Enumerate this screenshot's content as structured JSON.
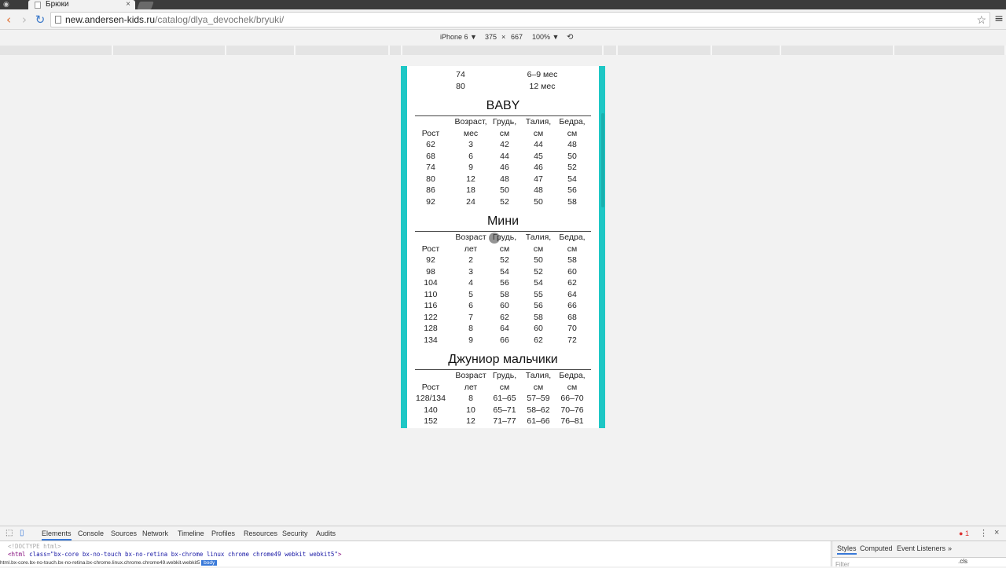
{
  "browser": {
    "tab_title": "Брюки",
    "url_host": "new.andersen-kids.ru",
    "url_path": "/catalog/dlya_devochek/bryuki/"
  },
  "device_toolbar": {
    "device": "iPhone 6 ▼",
    "width": "375",
    "times": "×",
    "height": "667",
    "zoom": "100% ▼"
  },
  "page": {
    "prev_rows": [
      [
        "74",
        "6–9 мес"
      ],
      [
        "80",
        "12 мес"
      ]
    ],
    "sections": [
      {
        "title": "BABY",
        "header_top": [
          "Возраст,",
          "Грудь,",
          "Талия,",
          "Бедра,"
        ],
        "header_bottom": [
          "Рост",
          "мес",
          "см",
          "см",
          "см"
        ],
        "rows": [
          [
            "62",
            "3",
            "42",
            "44",
            "48"
          ],
          [
            "68",
            "6",
            "44",
            "45",
            "50"
          ],
          [
            "74",
            "9",
            "46",
            "46",
            "52"
          ],
          [
            "80",
            "12",
            "48",
            "47",
            "54"
          ],
          [
            "86",
            "18",
            "50",
            "48",
            "56"
          ],
          [
            "92",
            "24",
            "52",
            "50",
            "58"
          ]
        ]
      },
      {
        "title": "Мини",
        "header_top": [
          "Возраст",
          "Грудь,",
          "Талия,",
          "Бедра,"
        ],
        "header_bottom": [
          "Рост",
          "лет",
          "см",
          "см",
          "см"
        ],
        "rows": [
          [
            "92",
            "2",
            "52",
            "50",
            "58"
          ],
          [
            "98",
            "3",
            "54",
            "52",
            "60"
          ],
          [
            "104",
            "4",
            "56",
            "54",
            "62"
          ],
          [
            "110",
            "5",
            "58",
            "55",
            "64"
          ],
          [
            "116",
            "6",
            "60",
            "56",
            "66"
          ],
          [
            "122",
            "7",
            "62",
            "58",
            "68"
          ],
          [
            "128",
            "8",
            "64",
            "60",
            "70"
          ],
          [
            "134",
            "9",
            "66",
            "62",
            "72"
          ]
        ]
      },
      {
        "title": "Джуниор мальчики",
        "header_top": [
          "Возраст",
          "Грудь,",
          "Талия,",
          "Бедра,"
        ],
        "header_bottom": [
          "Рост",
          "лет",
          "см",
          "см",
          "см"
        ],
        "rows": [
          [
            "128/134",
            "8",
            "61–65",
            "57–59",
            "66–70"
          ],
          [
            "140",
            "10",
            "65–71",
            "58–62",
            "70–76"
          ],
          [
            "152",
            "12",
            "71–77",
            "61–66",
            "76–81"
          ]
        ]
      }
    ]
  },
  "devtools": {
    "tabs": [
      "Elements",
      "Console",
      "Sources",
      "Network",
      "Timeline",
      "Profiles",
      "Resources",
      "Security",
      "Audits"
    ],
    "error_count": "1",
    "code_line1": "<!DOCTYPE html>",
    "code_tag": "<html ",
    "code_attr": "class=\"bx-core bx-no-touch bx-no-retina bx-chrome linux chrome chrome49 webkit webkit5\"",
    "code_end": ">",
    "breadcrumb": "html.bx-core.bx-no-touch.bx-no-retina.bx-chrome.linux.chrome.chrome49.webkit.webkit5",
    "breadcrumb_selected": "body",
    "side_tabs": [
      "Styles",
      "Computed",
      "Event Listeners"
    ],
    "filter_placeholder": "Filter",
    "cls_label": ".cls"
  },
  "colors": {
    "device_frame": "#1ec7c5",
    "accent": "#3879d9"
  }
}
